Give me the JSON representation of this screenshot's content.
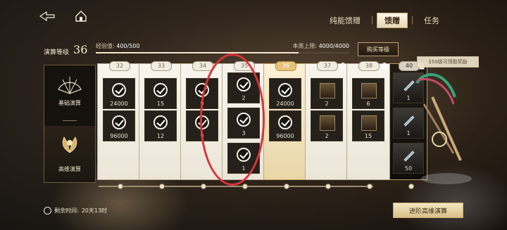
{
  "topbar": {
    "tabs": [
      {
        "label": "纯能馈赠",
        "active": false
      },
      {
        "label": "馈赠",
        "active": true
      },
      {
        "label": "任务",
        "active": false
      }
    ]
  },
  "header": {
    "level_sub": "演算等级",
    "level_label": "演算等级",
    "level_value": "36",
    "exp_label": "经验值:",
    "exp_value": "400/500",
    "exp_progress": 0.8,
    "weekly_label": "本周上限:",
    "weekly_value": "4000/4000",
    "buy_level_label": "购买等级"
  },
  "modes": [
    {
      "label": "基础演算",
      "icon": "fan-icon"
    },
    {
      "label": "高维演算",
      "icon": "lotus-icon"
    }
  ],
  "cards": [
    {
      "level": "32",
      "locked": false,
      "gold": false,
      "items": [
        {
          "qty": "24000",
          "claimed": true
        },
        {
          "qty": "96000",
          "claimed": true
        }
      ]
    },
    {
      "level": "33",
      "locked": false,
      "gold": false,
      "items": [
        {
          "qty": "15",
          "claimed": true
        },
        {
          "qty": "12",
          "claimed": true
        }
      ]
    },
    {
      "level": "34",
      "locked": false,
      "gold": false,
      "items": [
        {
          "qty": "9",
          "claimed": true
        },
        {
          "qty": "9",
          "claimed": true
        }
      ]
    },
    {
      "level": "35",
      "locked": false,
      "gold": false,
      "items": [
        {
          "qty": "2",
          "claimed": true
        },
        {
          "qty": "3",
          "claimed": true
        },
        {
          "qty": "1",
          "claimed": true
        }
      ]
    },
    {
      "level": "36",
      "locked": false,
      "gold": true,
      "items": [
        {
          "qty": "24000",
          "claimed": true
        },
        {
          "qty": "96000",
          "claimed": true
        }
      ]
    },
    {
      "level": "37",
      "locked": true,
      "gold": false,
      "items": [
        {
          "qty": "2",
          "claimed": false
        },
        {
          "qty": "2",
          "claimed": false
        }
      ]
    },
    {
      "level": "38",
      "locked": true,
      "gold": false,
      "items": [
        {
          "qty": "6",
          "claimed": false
        },
        {
          "qty": "15",
          "claimed": false
        }
      ]
    }
  ],
  "final_card": {
    "level": "40",
    "items": [
      {
        "qty": "1"
      },
      {
        "qty": "1"
      },
      {
        "qty": "50"
      }
    ]
  },
  "prize": {
    "banner": "150级可领取奖励"
  },
  "footer": {
    "timer_label": "剩余时间:",
    "timer_value": "20天13时",
    "advance_label": "进阶高维演算"
  }
}
